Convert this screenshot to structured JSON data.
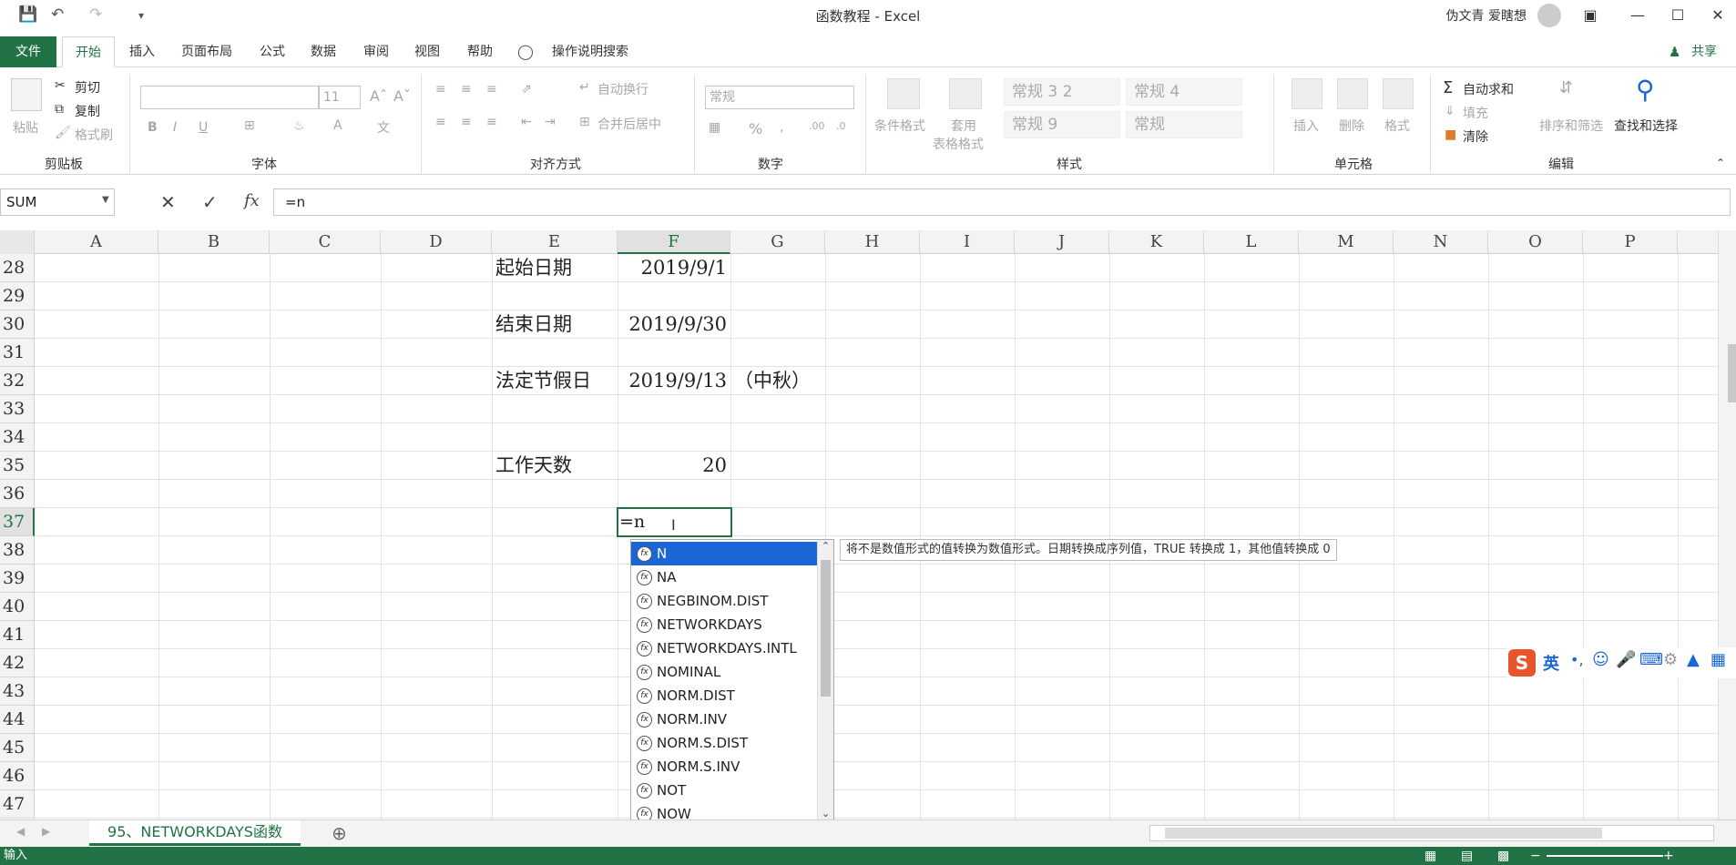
{
  "window": {
    "title": "函数教程 - Excel",
    "user": "伪文青 爱瞎想"
  },
  "ribbon": {
    "tabs": [
      "文件",
      "开始",
      "插入",
      "页面布局",
      "公式",
      "数据",
      "审阅",
      "视图",
      "帮助",
      "操作说明搜索"
    ],
    "share": "共享",
    "clipboard": {
      "paste": "粘贴",
      "cut": "剪切",
      "copy": "复制",
      "format_painter": "格式刷",
      "label": "剪贴板"
    },
    "font": {
      "size": "11",
      "label": "字体"
    },
    "alignment": {
      "wrap": "自动换行",
      "merge": "合并后居中",
      "label": "对齐方式"
    },
    "number": {
      "format": "常规",
      "label": "数字"
    },
    "styles": {
      "conditional": "条件格式",
      "table_fmt_1": "套用",
      "table_fmt_2": "表格格式",
      "cells": [
        "常规 3 2",
        "常规 4",
        "常规 9",
        "常规"
      ],
      "label": "样式"
    },
    "cells_group": {
      "insert": "插入",
      "delete": "删除",
      "format": "格式",
      "label": "单元格"
    },
    "editing": {
      "autosum": "自动求和",
      "fill": "填充",
      "clear": "清除",
      "sort": "排序和筛选",
      "find": "查找和选择",
      "label": "编辑"
    }
  },
  "formula_bar": {
    "name_box": "SUM",
    "formula": "=n"
  },
  "grid": {
    "columns": [
      "A",
      "B",
      "C",
      "D",
      "E",
      "F",
      "G",
      "H",
      "I",
      "J",
      "K",
      "L",
      "M",
      "N",
      "O",
      "P"
    ],
    "rows": [
      "28",
      "29",
      "30",
      "31",
      "32",
      "33",
      "34",
      "35",
      "36",
      "37",
      "38",
      "39",
      "40",
      "41",
      "42",
      "43",
      "44",
      "45",
      "46",
      "47"
    ],
    "cells": {
      "e28": "起始日期",
      "f28": "2019/9/1",
      "e30": "结束日期",
      "f30": "2019/9/30",
      "e32": "法定节假日",
      "f32": "2019/9/13",
      "g32": "（中秋）",
      "e35": "工作天数",
      "f35": "20",
      "f37": "=n"
    }
  },
  "autocomplete": {
    "items": [
      "N",
      "NA",
      "NEGBINOM.DIST",
      "NETWORKDAYS",
      "NETWORKDAYS.INTL",
      "NOMINAL",
      "NORM.DIST",
      "NORM.INV",
      "NORM.S.DIST",
      "NORM.S.INV",
      "NOT",
      "NOW"
    ],
    "tooltip": "将不是数值形式的值转换为数值形式。日期转换成序列值，TRUE 转换成 1，其他值转换成 0"
  },
  "sheets": {
    "active": "95、NETWORKDAYS函数"
  },
  "status": {
    "mode": "输入"
  },
  "ime": {
    "lang": "英"
  },
  "colors": {
    "accent": "#217346",
    "selection": "#1a66d6"
  }
}
